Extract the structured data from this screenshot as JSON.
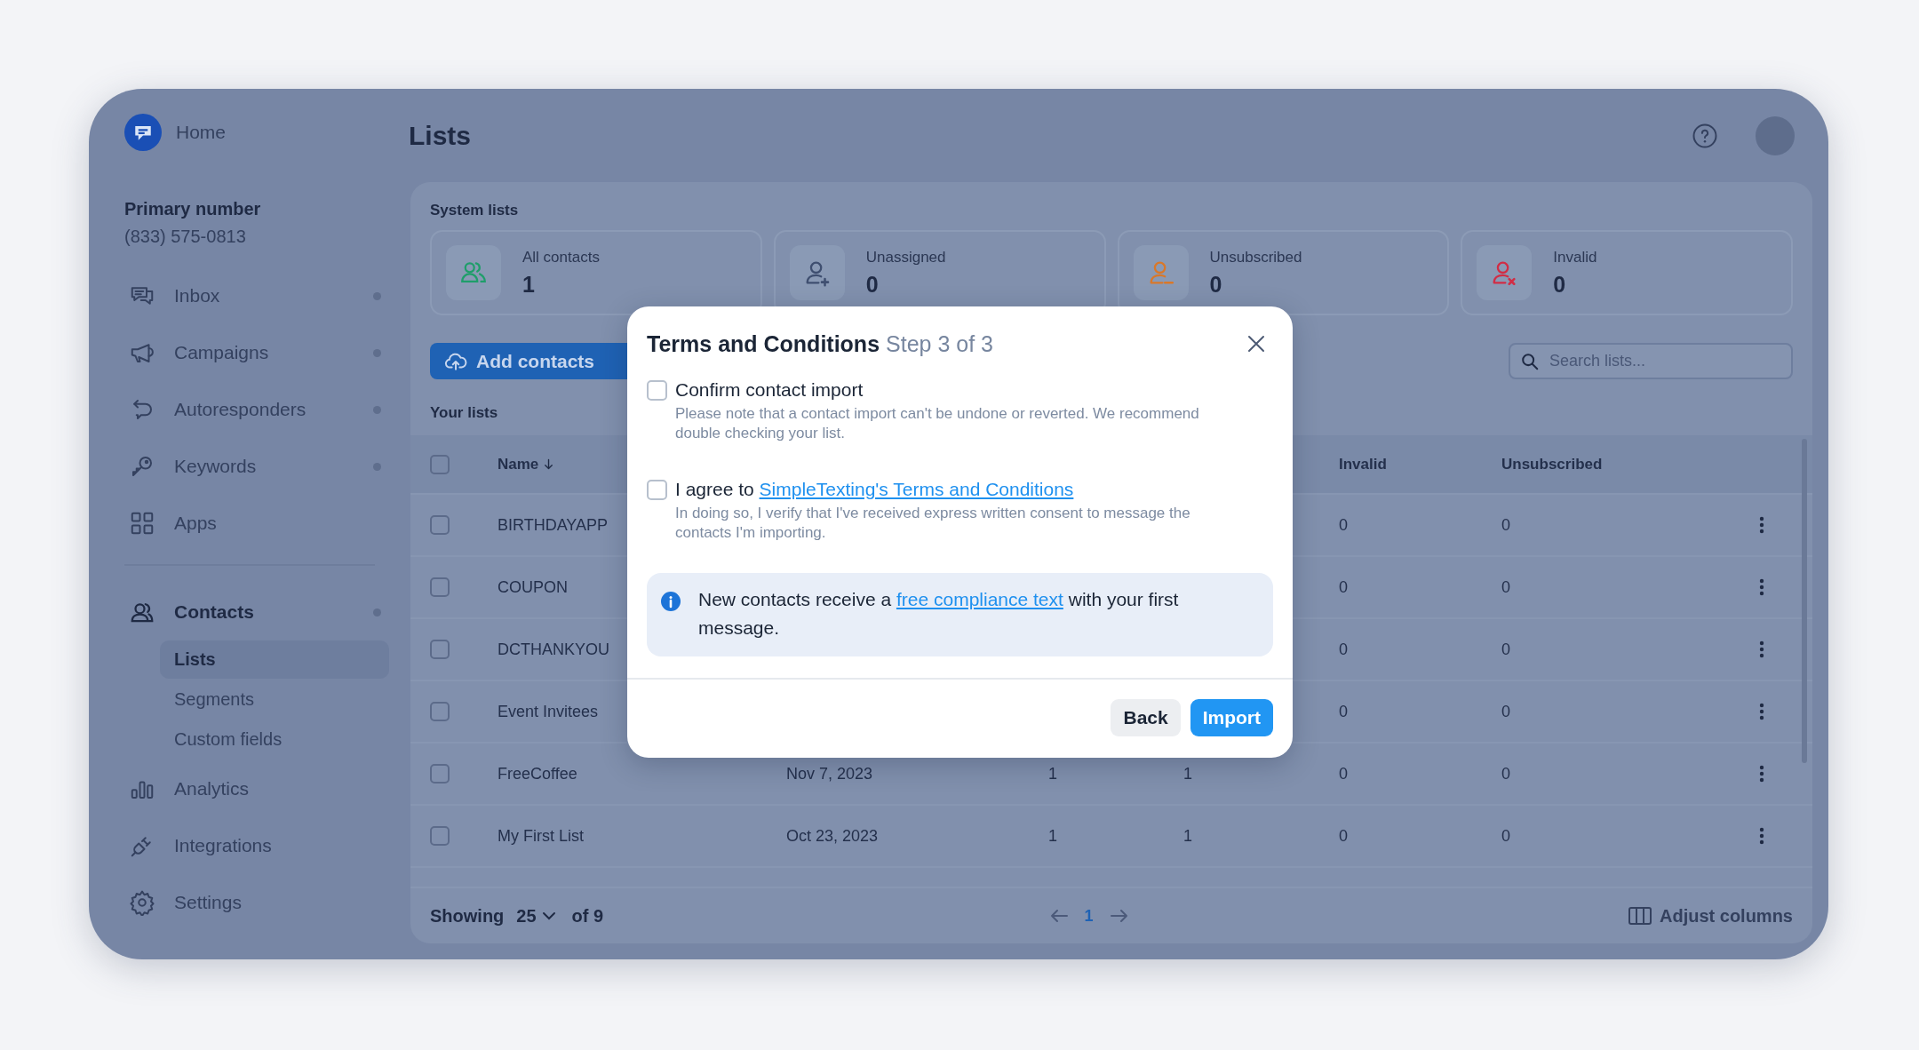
{
  "sidebar": {
    "home": "Home",
    "primary_number": {
      "label": "Primary number",
      "value": "(833) 575-0813"
    },
    "groups": [
      [
        {
          "label": "Inbox",
          "dot": true
        },
        {
          "label": "Campaigns",
          "dot": true
        },
        {
          "label": "Autoresponders",
          "dot": true
        },
        {
          "label": "Keywords",
          "dot": true
        },
        {
          "label": "Apps",
          "dot": false
        }
      ],
      [
        {
          "label": "Contacts",
          "dot": true,
          "expanded": true,
          "children": [
            {
              "label": "Lists",
              "selected": true
            },
            {
              "label": "Segments",
              "selected": false
            },
            {
              "label": "Custom fields",
              "selected": false
            }
          ]
        },
        {
          "label": "Analytics",
          "dot": false
        },
        {
          "label": "Integrations",
          "dot": false
        },
        {
          "label": "Settings",
          "dot": false
        }
      ]
    ]
  },
  "header": {
    "title": "Lists"
  },
  "system_lists": {
    "title": "System lists",
    "cards": [
      {
        "label": "All contacts",
        "count": "1",
        "color": "#1f9e6a"
      },
      {
        "label": "Unassigned",
        "count": "0",
        "color": "#3f4f70"
      },
      {
        "label": "Unsubscribed",
        "count": "0",
        "color": "#d9782a"
      },
      {
        "label": "Invalid",
        "count": "0",
        "color": "#d12d45"
      }
    ]
  },
  "toolbar": {
    "add_button": "Add contacts",
    "search": {
      "placeholder": "Search lists..."
    }
  },
  "your_lists": {
    "title": "Your lists",
    "header_checked": false,
    "columns": [
      {
        "label": "Name",
        "sorted": true
      },
      {
        "label": "Invalid",
        "sorted": false
      },
      {
        "label": "Unsubscribed",
        "sorted": false
      }
    ],
    "rows": [
      {
        "name": "BIRTHDAYAPP",
        "invalid": "0",
        "unsubscribed": "0",
        "checked": false
      },
      {
        "name": "COUPON",
        "invalid": "0",
        "unsubscribed": "0",
        "checked": false
      },
      {
        "name": "DCTHANKYOU",
        "invalid": "0",
        "unsubscribed": "0",
        "checked": false
      },
      {
        "name": "Event Invitees",
        "invalid": "0",
        "unsubscribed": "0",
        "checked": false
      },
      {
        "name": "FreeCoffee",
        "date": "Nov 7, 2023",
        "column_3": "1",
        "column_4": "1",
        "invalid": "0",
        "unsubscribed": "0",
        "checked": false
      },
      {
        "name": "My First List",
        "date": "Oct 23, 2023",
        "column_3": "1",
        "column_4": "1",
        "invalid": "0",
        "unsubscribed": "0",
        "checked": false
      }
    ]
  },
  "footer": {
    "showing": "Showing",
    "page_size": "25",
    "of_total": "of 9",
    "pages": [
      {
        "label": "1",
        "selected": true
      }
    ],
    "adjust_columns": "Adjust columns"
  },
  "modal": {
    "title": "Terms and Conditions",
    "step": "Step 3 of 3",
    "options": [
      {
        "label": "Confirm contact import",
        "description": "Please note that a contact import can't be undone or reverted. We recommend double checking your list.",
        "checked": false
      },
      {
        "label": "I agree to",
        "link": "SimpleTexting's Terms and Conditions",
        "description": "In doing so, I verify that I've received express written consent to message the contacts I'm importing.",
        "checked": false
      }
    ],
    "info": {
      "text_before": "New contacts receive a",
      "link": "free compliance text",
      "text_after": "with your first message."
    },
    "buttons": [
      {
        "label": "Back",
        "kind": "secondary"
      },
      {
        "label": "Import",
        "kind": "primary"
      }
    ]
  }
}
